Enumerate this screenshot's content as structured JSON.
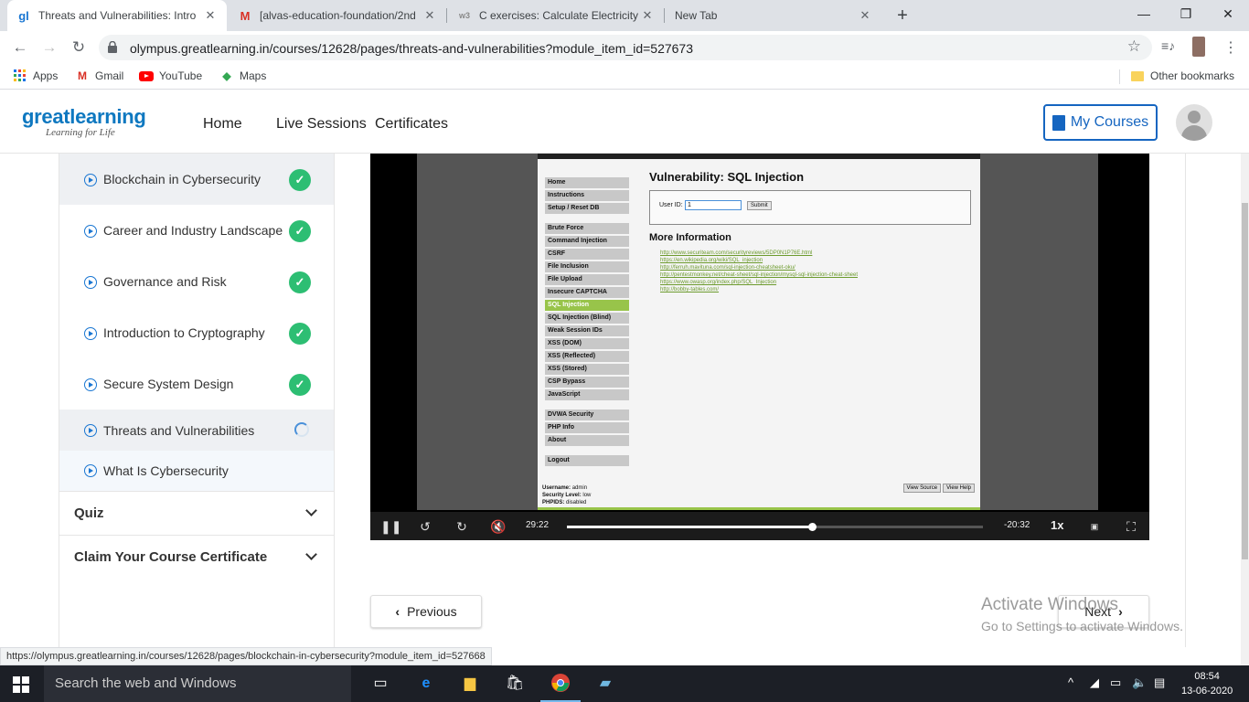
{
  "browser": {
    "tabs": [
      {
        "label": "Threats and Vulnerabilities: Intro",
        "icon": "gl"
      },
      {
        "label": "[alvas-education-foundation/2nd",
        "icon": "M"
      },
      {
        "label": "C exercises: Calculate Electricity B",
        "icon": "w3"
      },
      {
        "label": "New Tab",
        "icon": ""
      }
    ],
    "url": "olympus.greatlearning.in/courses/12628/pages/threats-and-vulnerabilities?module_item_id=527673",
    "bookmarks": [
      "Apps",
      "Gmail",
      "YouTube",
      "Maps"
    ],
    "other_bookmarks": "Other bookmarks"
  },
  "site": {
    "logo_main": "greatlearning",
    "logo_tag": "Learning for Life",
    "nav": [
      "Home",
      "Live Sessions",
      "Certificates"
    ],
    "my_courses": "My Courses"
  },
  "sidebar": {
    "modules": [
      {
        "label": "Blockchain in Cybersecurity",
        "status": "done"
      },
      {
        "label": "Career and Industry Landscape",
        "status": "done"
      },
      {
        "label": "Governance and Risk",
        "status": "done"
      },
      {
        "label": "Introduction to Cryptography",
        "status": "done"
      },
      {
        "label": "Secure System Design",
        "status": "done"
      },
      {
        "label": "Threats and Vulnerabilities",
        "status": "loading"
      },
      {
        "label": "What Is Cybersecurity",
        "status": "none"
      }
    ],
    "sections": [
      "Quiz",
      "Claim Your Course Certificate"
    ]
  },
  "video": {
    "dvwa": {
      "menu_top": [
        "Home",
        "Instructions",
        "Setup / Reset DB"
      ],
      "menu_vulns": [
        "Brute Force",
        "Command Injection",
        "CSRF",
        "File Inclusion",
        "File Upload",
        "Insecure CAPTCHA",
        "SQL Injection",
        "SQL Injection (Blind)",
        "Weak Session IDs",
        "XSS (DOM)",
        "XSS (Reflected)",
        "XSS (Stored)",
        "CSP Bypass",
        "JavaScript"
      ],
      "menu_bottom": [
        "DVWA Security",
        "PHP Info",
        "About"
      ],
      "menu_logout": "Logout",
      "title": "Vulnerability: SQL Injection",
      "user_id_label": "User ID:",
      "user_id_value": "1",
      "submit": "Submit",
      "more_info": "More Information",
      "links": [
        "http://www.securiteam.com/securityreviews/5DP0N1P76E.html",
        "https://en.wikipedia.org/wiki/SQL_injection",
        "http://ferruh.mavituna.com/sql-injection-cheatsheet-oku/",
        "http://pentestmonkey.net/cheat-sheet/sql-injection/mysql-sql-injection-cheat-sheet",
        "https://www.owasp.org/index.php/SQL_Injection",
        "http://bobby-tables.com/"
      ],
      "footer_username": "admin",
      "footer_security": "low",
      "footer_phpids": "disabled",
      "view_source": "View Source",
      "view_help": "View Help"
    },
    "current_time": "29:22",
    "remaining_time": "-20:32",
    "speed": "1x",
    "progress": 0.59
  },
  "pager": {
    "previous": "Previous",
    "next": "Next"
  },
  "watermark": {
    "line1": "Activate Windows",
    "line2": "Go to Settings to activate Windows."
  },
  "status_url": "https://olympus.greatlearning.in/courses/12628/pages/blockchain-in-cybersecurity?module_item_id=527668",
  "taskbar": {
    "search_placeholder": "Search the web and Windows",
    "time": "08:54",
    "date": "13-06-2020"
  },
  "colors": {
    "accent": "#1565c0",
    "done_green": "#2dbe73",
    "dvwa_green": "#98c44a"
  }
}
